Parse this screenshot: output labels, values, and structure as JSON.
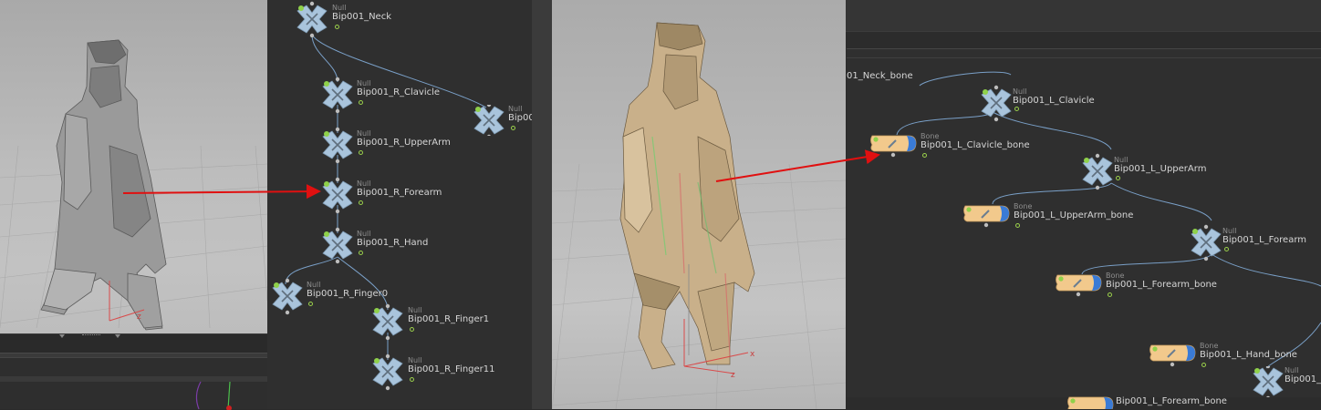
{
  "left_network": {
    "nodes": [
      {
        "id": "neck",
        "type": "Null",
        "name": "Bip001_Neck"
      },
      {
        "id": "rclav",
        "type": "Null",
        "name": "Bip001_R_Clavicle"
      },
      {
        "id": "offnode",
        "type": "Null",
        "name": "Bip00"
      },
      {
        "id": "rupper",
        "type": "Null",
        "name": "Bip001_R_UpperArm"
      },
      {
        "id": "rfore",
        "type": "Null",
        "name": "Bip001_R_Forearm"
      },
      {
        "id": "rhand",
        "type": "Null",
        "name": "Bip001_R_Hand"
      },
      {
        "id": "rfing0",
        "type": "Null",
        "name": "Bip001_R_Finger0"
      },
      {
        "id": "rfing1",
        "type": "Null",
        "name": "Bip001_R_Finger1"
      },
      {
        "id": "rfing11",
        "type": "Null",
        "name": "Bip001_R_Finger11"
      }
    ]
  },
  "right_network": {
    "nodes": [
      {
        "id": "neckbone",
        "type": "",
        "name": "01_Neck_bone"
      },
      {
        "id": "lclav",
        "type": "Null",
        "name": "Bip001_L_Clavicle"
      },
      {
        "id": "lclavbone",
        "type": "Bone",
        "name": "Bip001_L_Clavicle_bone"
      },
      {
        "id": "lupper",
        "type": "Null",
        "name": "Bip001_L_UpperArm"
      },
      {
        "id": "lupperbone",
        "type": "Bone",
        "name": "Bip001_L_UpperArm_bone"
      },
      {
        "id": "lfore",
        "type": "Null",
        "name": "Bip001_L_Forearm"
      },
      {
        "id": "lforebone",
        "type": "Bone",
        "name": "Bip001_L_Forearm_bone"
      },
      {
        "id": "lhandbone",
        "type": "Bone",
        "name": "Bip001_L_Hand_bone"
      },
      {
        "id": "lhandnull",
        "type": "Null",
        "name": "Bip001_"
      },
      {
        "id": "lforebone2",
        "type": "",
        "name": "Bip001_L_Forearm_bone"
      }
    ]
  },
  "viewport1": {
    "axis_label": "z"
  },
  "viewport2": {
    "axis_x_label": "x",
    "axis_z_label": "z"
  },
  "colors": {
    "null_node": "#a9c4dc",
    "bone_node": "#f2c98c",
    "bone_cap": "#3a7bd6",
    "wire": "#7aa0c8",
    "annotation_arrow": "#e01010",
    "flag_green": "#8fd14a"
  },
  "icons": [
    "null-node-icon",
    "bone-node-icon",
    "annotation-arrow"
  ]
}
